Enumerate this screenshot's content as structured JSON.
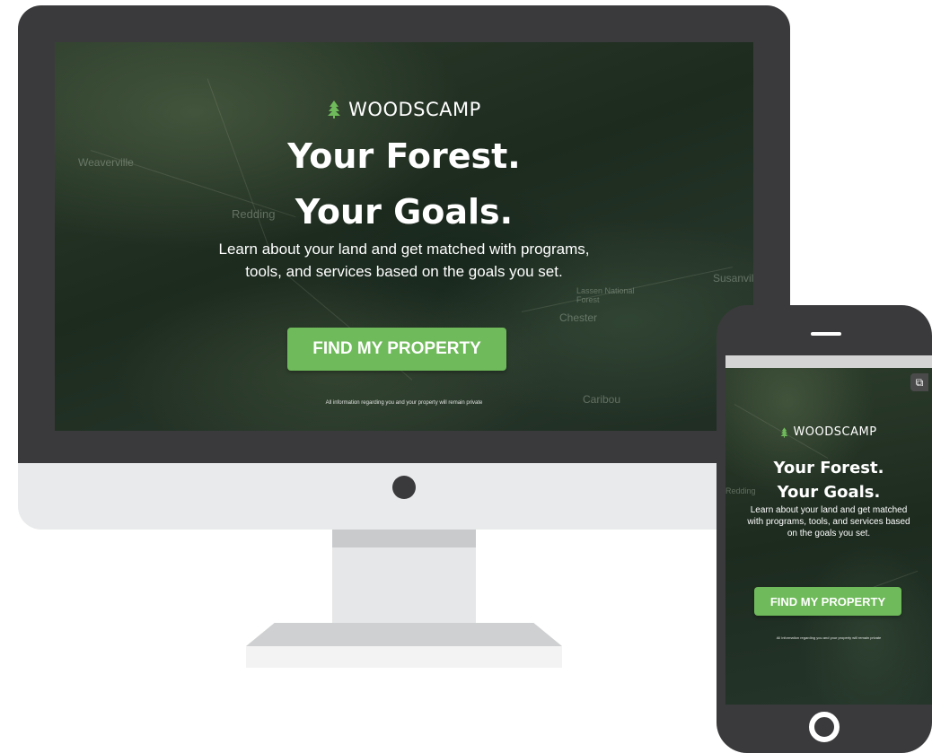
{
  "desktop": {
    "brand": "WOODSCAMP",
    "headline_line1": "Your Forest.",
    "headline_line2": "Your Goals.",
    "subtext_line1": "Learn about your land and get matched with programs,",
    "subtext_line2": "tools, and services based on the goals you set.",
    "cta_label": "FIND MY PROPERTY",
    "privacy_note": "All information regarding you and your property will remain private",
    "map_labels": {
      "weaverville": "Weaverville",
      "redding": "Redding",
      "chester": "Chester",
      "susanville": "Susanvil",
      "caribou": "Caribou",
      "lassen": "Lassen National Forest"
    }
  },
  "mobile": {
    "brand": "WOODSCAMP",
    "headline_line1": "Your Forest.",
    "headline_line2": "Your Goals.",
    "subtext": "Learn about your land and get matched with programs, tools, and services based on the goals you set.",
    "cta_label": "FIND MY PROPERTY",
    "privacy_note": "All information regarding you and your property will remain private",
    "map_labels": {
      "redding": "Redding"
    },
    "chat_badge_icon": "hubspot-sprocket-icon"
  },
  "colors": {
    "bezel": "#3a3a3c",
    "chin": "#e9eaeb",
    "cta_green": "#6fba5a",
    "forest_dark": "#1d2b1f"
  }
}
